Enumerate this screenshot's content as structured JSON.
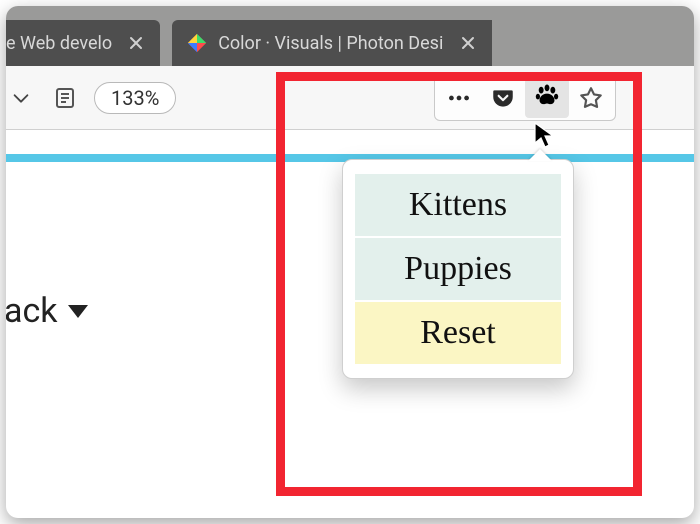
{
  "tabs": [
    {
      "label": "e Web develo"
    },
    {
      "label": "Color · Visuals | Photon Design"
    }
  ],
  "toolbar": {
    "zoom_label": "133%"
  },
  "page": {
    "left_label": "ack"
  },
  "popup": {
    "items": [
      {
        "label": "Kittens",
        "kind": "a"
      },
      {
        "label": "Puppies",
        "kind": "a"
      },
      {
        "label": "Reset",
        "kind": "b"
      }
    ]
  }
}
